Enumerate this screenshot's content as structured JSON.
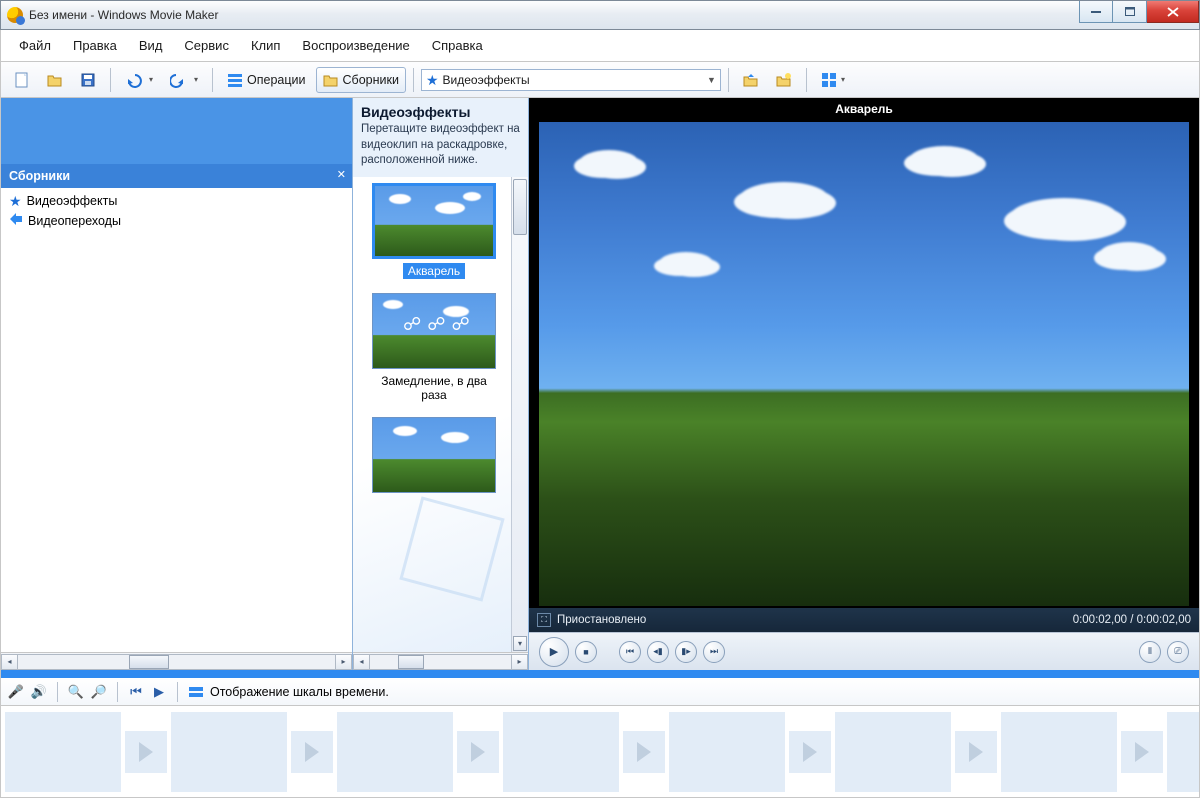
{
  "title": "Без имени - Windows Movie Maker",
  "menu": {
    "file": "Файл",
    "edit": "Правка",
    "view": "Вид",
    "tools": "Сервис",
    "clip": "Клип",
    "play": "Воспроизведение",
    "help": "Справка"
  },
  "toolbar": {
    "tasks": "Операции",
    "collections": "Сборники",
    "dropdown": "Видеоэффекты"
  },
  "sidebar": {
    "header": "Сборники",
    "items": [
      "Видеоэффекты",
      "Видеопереходы"
    ]
  },
  "effects": {
    "title": "Видеоэффекты",
    "subtitle": "Перетащите видеоэффект на видеоклип на раскадровке, расположенной ниже.",
    "items": [
      {
        "label": "Акварель",
        "selected": true
      },
      {
        "label": "Замедление, в два раза",
        "selected": false
      },
      {
        "label": "",
        "selected": false
      }
    ]
  },
  "preview": {
    "clip_title": "Акварель",
    "status": "Приостановлено",
    "time_current": "0:00:02,00",
    "time_total": "0:00:02,00"
  },
  "timeline": {
    "hint": "Отображение шкалы времени."
  }
}
